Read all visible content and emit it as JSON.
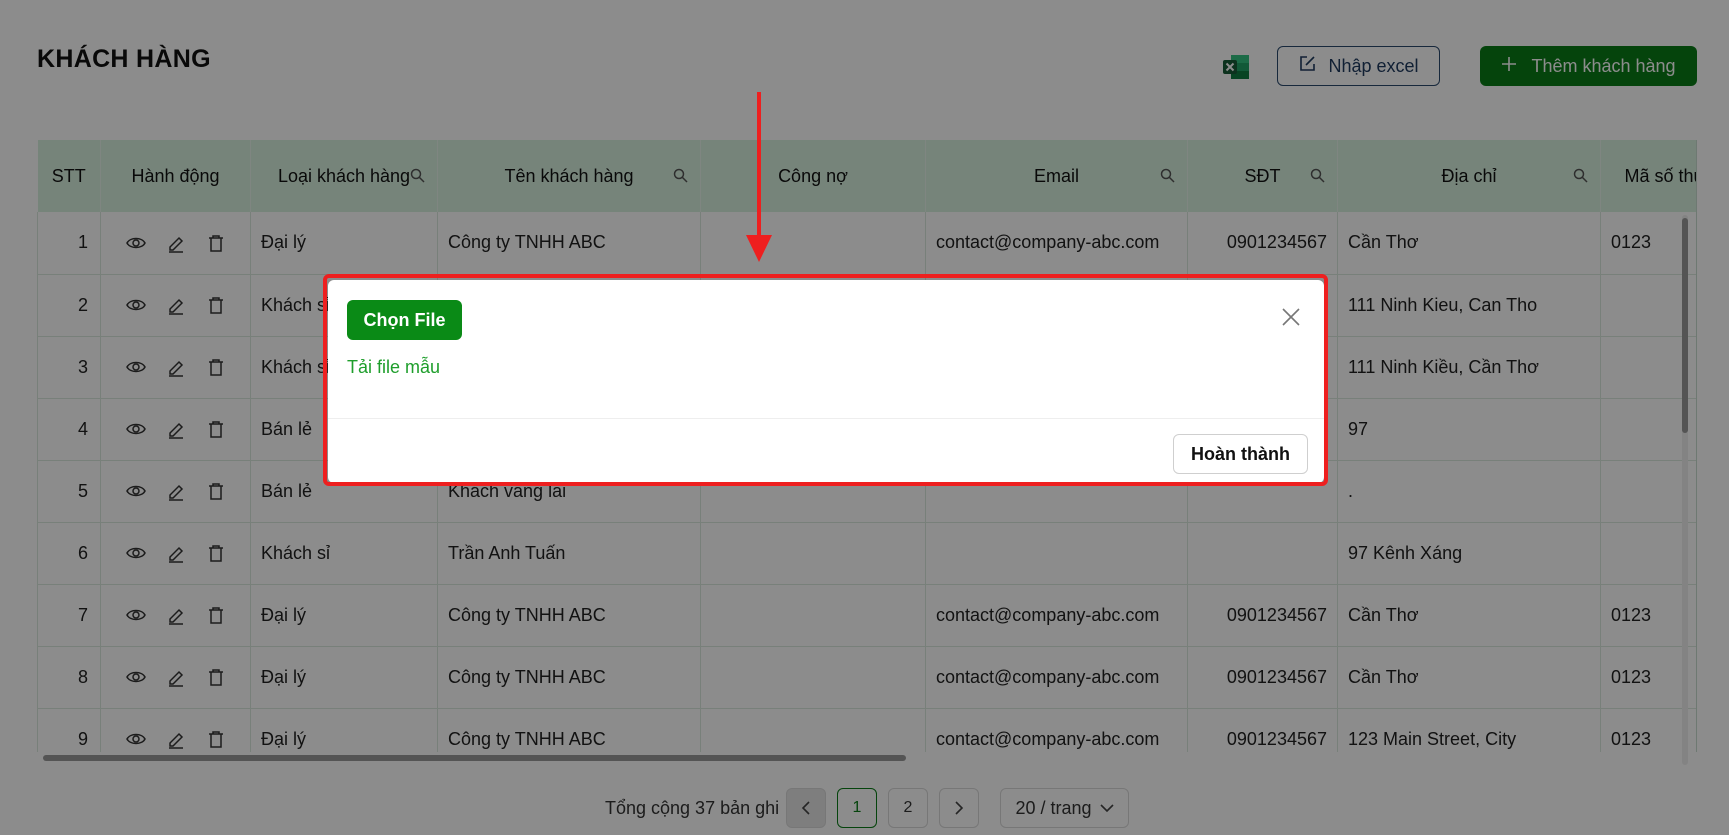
{
  "page": {
    "title": "KHÁCH HÀNG",
    "excel_icon": "excel-icon",
    "import_button": "Nhập excel",
    "add_button": "Thêm khách hàng"
  },
  "table": {
    "headers": [
      "STT",
      "Hành động",
      "Loại khách hàng",
      "Tên khách hàng",
      "Công nợ",
      "Email",
      "SĐT",
      "Địa chỉ",
      "Mã số thuế"
    ],
    "searchable_columns": [
      "Loại khách hàng",
      "Tên khách hàng",
      "Email",
      "SĐT",
      "Địa chỉ"
    ],
    "action_icons": [
      "eye-icon",
      "edit-icon",
      "trash-icon"
    ],
    "rows": [
      {
        "stt": "1",
        "type": "Đại lý",
        "name": "Công ty TNHH ABC",
        "debt": "",
        "email": "contact@company-abc.com",
        "phone": "0901234567",
        "address": "Cần Thơ",
        "tax": "0123"
      },
      {
        "stt": "2",
        "type": "Khách sỉ",
        "name": "",
        "debt": "",
        "email": "",
        "phone": "",
        "address": "111 Ninh Kieu, Can Tho",
        "tax": ""
      },
      {
        "stt": "3",
        "type": "Khách sỉ",
        "name": "",
        "debt": "",
        "email": "",
        "phone": "",
        "address": "111 Ninh Kiều, Cần Thơ",
        "tax": ""
      },
      {
        "stt": "4",
        "type": "Bán lẻ",
        "name": "",
        "debt": "",
        "email": "",
        "phone": "",
        "address": "97",
        "tax": ""
      },
      {
        "stt": "5",
        "type": "Bán lẻ",
        "name": "Khách vãng lai",
        "debt": "",
        "email": "",
        "phone": "",
        "address": ".",
        "tax": ""
      },
      {
        "stt": "6",
        "type": "Khách sỉ",
        "name": "Trần Anh Tuấn",
        "debt": "",
        "email": "",
        "phone": "",
        "address": "97 Kênh Xáng",
        "tax": ""
      },
      {
        "stt": "7",
        "type": "Đại lý",
        "name": "Công ty TNHH ABC",
        "debt": "",
        "email": "contact@company-abc.com",
        "phone": "0901234567",
        "address": "Cần Thơ",
        "tax": "0123"
      },
      {
        "stt": "8",
        "type": "Đại lý",
        "name": "Công ty TNHH ABC",
        "debt": "",
        "email": "contact@company-abc.com",
        "phone": "0901234567",
        "address": "Cần Thơ",
        "tax": "0123"
      },
      {
        "stt": "9",
        "type": "Đại lý",
        "name": "Công ty TNHH ABC",
        "debt": "",
        "email": "contact@company-abc.com",
        "phone": "0901234567",
        "address": "123 Main Street, City",
        "tax": "0123"
      }
    ]
  },
  "pagination": {
    "total_text": "Tổng cộng 37 bản ghi",
    "pages": [
      "1",
      "2"
    ],
    "current_page": "1",
    "page_size": "20 / trang"
  },
  "modal": {
    "choose_file": "Chọn File",
    "download_template": "Tải file mẫu",
    "done": "Hoàn thành"
  },
  "colors": {
    "primary_green": "#0a7d16",
    "header_bg": "#d7f0df",
    "highlight_red": "#ee1f1f",
    "link_green": "#1e9e2b"
  }
}
